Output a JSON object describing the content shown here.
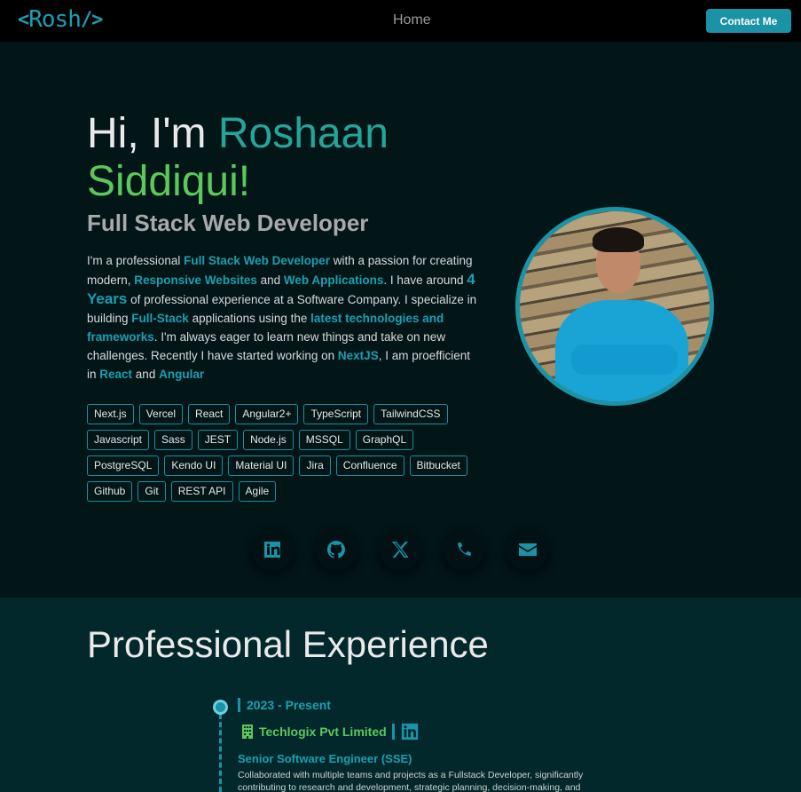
{
  "nav": {
    "logo_left": "<",
    "logo_text": "Rosh",
    "logo_right": "/>",
    "home_label": "Home",
    "contact_label": "Contact Me"
  },
  "hero": {
    "greeting": "Hi, I'm ",
    "first_name": "Roshaan",
    "last_name": "Siddiqui!",
    "subtitle": "Full Stack Web Developer",
    "intro": {
      "t1": "I'm a professional ",
      "h1": "Full Stack Web Developer",
      "t2": " with a passion for creating modern, ",
      "h2": "Responsive Websites",
      "t3": " and ",
      "h3": "Web Applications",
      "t4": ". I have around ",
      "h4": "4 Years",
      "t5": " of professional experience at a Software Company. I specialize in building ",
      "h5": "Full-Stack",
      "t6": " applications using the ",
      "h6": "latest technologies and frameworks",
      "t7": ". I'm always eager to learn new things and take on new challenges. Recently I have started working on ",
      "h7": "NextJS",
      "t8": ", I am proefficient in ",
      "h8": "React",
      "t9": " and ",
      "h9": "Angular"
    },
    "skills": [
      "Next.js",
      "Vercel",
      "React",
      "Angular2+",
      "TypeScript",
      "TailwindCSS",
      "Javascript",
      "Sass",
      "JEST",
      "Node.js",
      "MSSQL",
      "GraphQL",
      "PostgreSQL",
      "Kendo UI",
      "Material UI",
      "Jira",
      "Confluence",
      "Bitbucket",
      "Github",
      "Git",
      "REST API",
      "Agile"
    ],
    "socials": [
      "linkedin-icon",
      "github-icon",
      "x-icon",
      "phone-icon",
      "email-icon"
    ]
  },
  "experience": {
    "title": "Professional Experience",
    "items": [
      {
        "period": "2023 - Present",
        "company": "Techlogix Pvt Limited",
        "role": "Senior Software Engineer (SSE)",
        "description": "Collaborated with multiple teams and projects as a Fullstack Developer, significantly contributing to research and development, strategic planning, decision-making, and"
      }
    ]
  },
  "colors": {
    "accent": "#1a93a6",
    "green": "#5cc85c",
    "teal": "#25a59a"
  }
}
